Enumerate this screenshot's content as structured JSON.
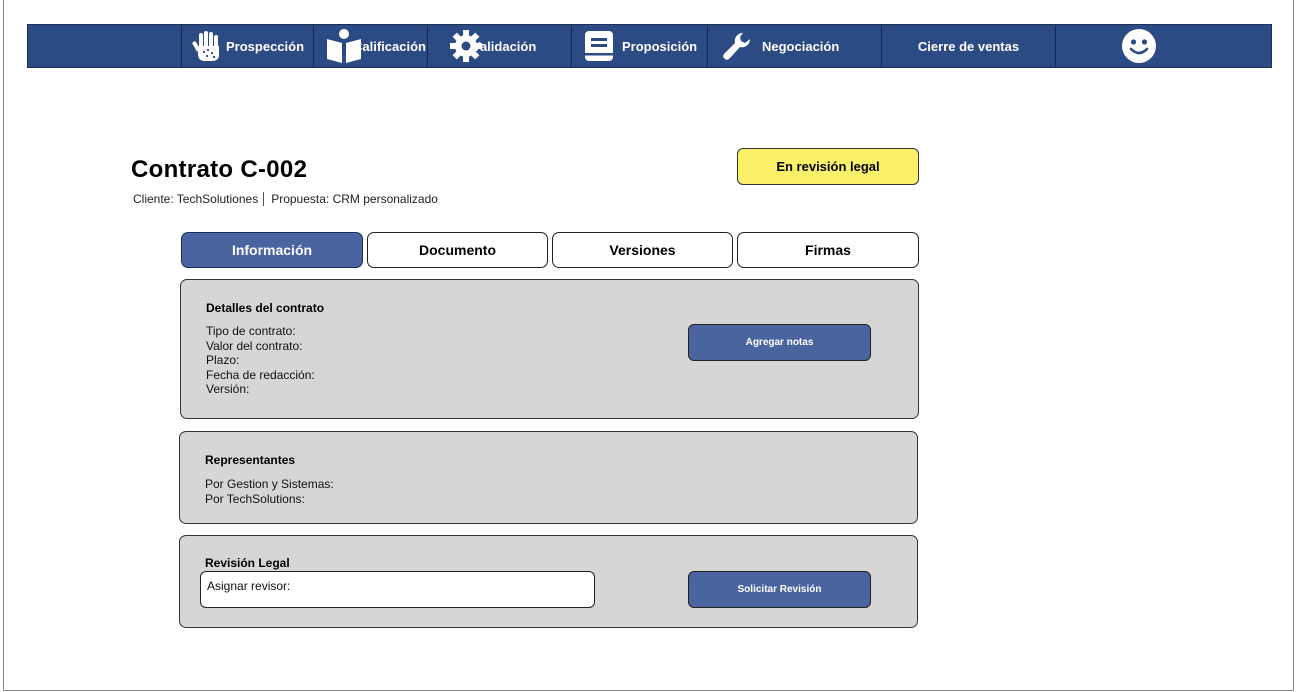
{
  "nav": {
    "items": [
      {
        "label": "Prospección",
        "icon": "hand-icon"
      },
      {
        "label": "Calificación",
        "icon": "reading-person-icon"
      },
      {
        "label": "Validación",
        "icon": "gear-icon"
      },
      {
        "label": "Proposición",
        "icon": "book-icon"
      },
      {
        "label": "Negociación",
        "icon": "wrench-icon"
      },
      {
        "label": "Cierre de ventas",
        "icon": ""
      }
    ],
    "profile_icon": "smiley-face-icon"
  },
  "contract": {
    "title": "Contrato C-002",
    "client": "Cliente: TechSolutiones",
    "proposal": "Propuesta: CRM personalizado",
    "status": "En revisión legal"
  },
  "tabs": [
    {
      "label": "Información",
      "active": true
    },
    {
      "label": "Documento",
      "active": false
    },
    {
      "label": "Versiones",
      "active": false
    },
    {
      "label": "Firmas",
      "active": false
    }
  ],
  "details": {
    "heading": "Detalles del contrato",
    "fields": [
      "Tipo de contrato:",
      "Valor del contrato:",
      "Plazo:",
      "Fecha de redacción:",
      "Versión:"
    ],
    "notes_button": "Agregar notas"
  },
  "representatives": {
    "heading": "Representantes",
    "fields": [
      "Por Gestion y Sistemas:",
      "Por TechSolutions:"
    ]
  },
  "legal_review": {
    "heading": "Revisión Legal",
    "reviewer_value": "Asignar revisor:",
    "request_button": "Solicitar Revisión"
  },
  "colors": {
    "nav_bg": "#2c4a84",
    "accent": "#4a64a0",
    "status_badge": "#fbf06a",
    "panel_bg": "#d6d6d6"
  }
}
